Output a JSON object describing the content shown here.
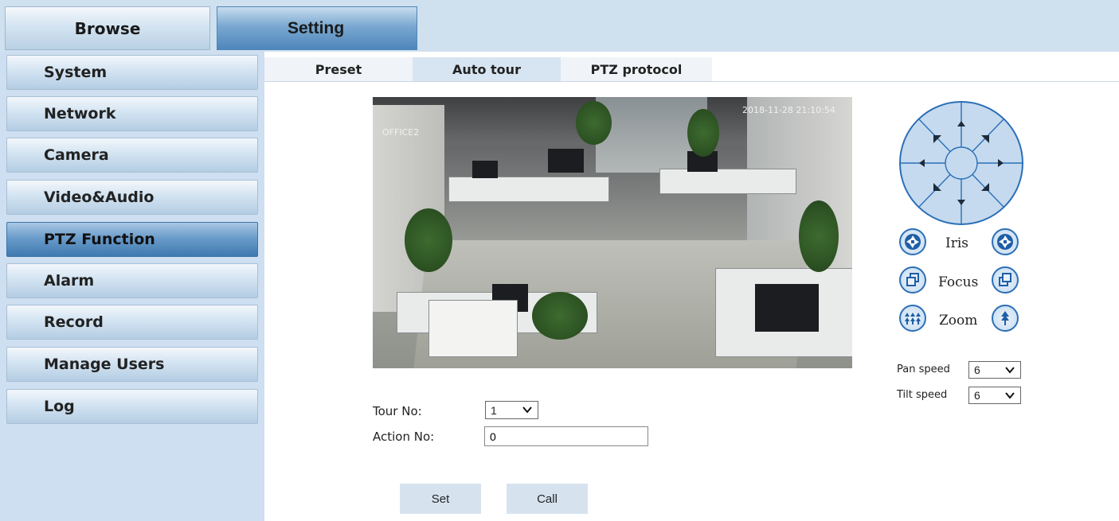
{
  "topbar": {
    "browse_label": "Browse",
    "setting_label": "Setting"
  },
  "sidebar": {
    "items": [
      {
        "label": "System"
      },
      {
        "label": "Network"
      },
      {
        "label": "Camera"
      },
      {
        "label": "Video&Audio"
      },
      {
        "label": "PTZ Function",
        "active": true
      },
      {
        "label": "Alarm"
      },
      {
        "label": "Record"
      },
      {
        "label": "Manage Users"
      },
      {
        "label": "Log"
      }
    ]
  },
  "subtabs": [
    {
      "label": "Preset"
    },
    {
      "label": "Auto tour",
      "active": true
    },
    {
      "label": "PTZ protocol"
    }
  ],
  "video": {
    "osd_name": "OFFICE2",
    "osd_time": "2018-11-28  21:10:54"
  },
  "ptz": {
    "iris_label": "Iris",
    "focus_label": "Focus",
    "zoom_label": "Zoom",
    "pan_speed_label": "Pan speed",
    "pan_speed_value": "6",
    "tilt_speed_label": "Tilt speed",
    "tilt_speed_value": "6"
  },
  "tour_form": {
    "tour_no_label": "Tour No:",
    "tour_no_value": "1",
    "action_no_label": "Action No:",
    "action_no_value": "0",
    "set_label": "Set",
    "call_label": "Call"
  },
  "colors": {
    "accent": "#2c6fb8",
    "sidebar_bg": "#cddff0",
    "active_tab": "#4f86bb"
  }
}
